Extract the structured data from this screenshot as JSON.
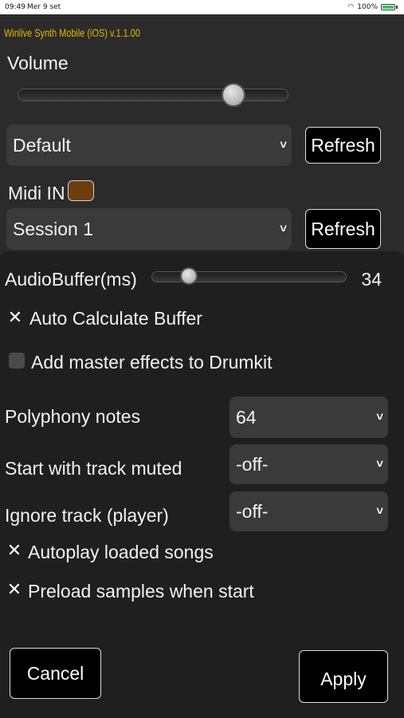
{
  "status_bar": {
    "time": "09:49",
    "date": "Mer 9 set",
    "battery": "100%"
  },
  "app": {
    "title": "Winlive Synth Mobile (iOS) v.1.1.00"
  },
  "volume": {
    "label": "Volume",
    "level_fraction": 0.8
  },
  "audio_output": {
    "selected": "Default",
    "refresh_label": "Refresh"
  },
  "midi": {
    "label": "Midi IN",
    "selected": "Session 1",
    "refresh_label": "Refresh"
  },
  "settings": {
    "audio_buffer": {
      "label": "AudioBuffer(ms)",
      "value": "34"
    },
    "auto_calculate_buffer": {
      "label": "Auto Calculate Buffer",
      "checked": true
    },
    "add_master_effects": {
      "label": "Add master effects to Drumkit",
      "checked": false
    },
    "polyphony": {
      "label": "Polyphony notes",
      "selected": "64"
    },
    "start_muted": {
      "label": "Start with track muted",
      "selected": "-off-"
    },
    "ignore_track": {
      "label": "Ignore track (player)",
      "selected": "-off-"
    },
    "autoplay": {
      "label": "Autoplay loaded songs",
      "checked": true
    },
    "preload": {
      "label": "Preload samples when start",
      "checked": true
    }
  },
  "footer": {
    "cancel_label": "Cancel",
    "apply_label": "Apply"
  },
  "icons": {
    "chevron": "chevron-down-icon",
    "check": "checkmark-icon"
  }
}
